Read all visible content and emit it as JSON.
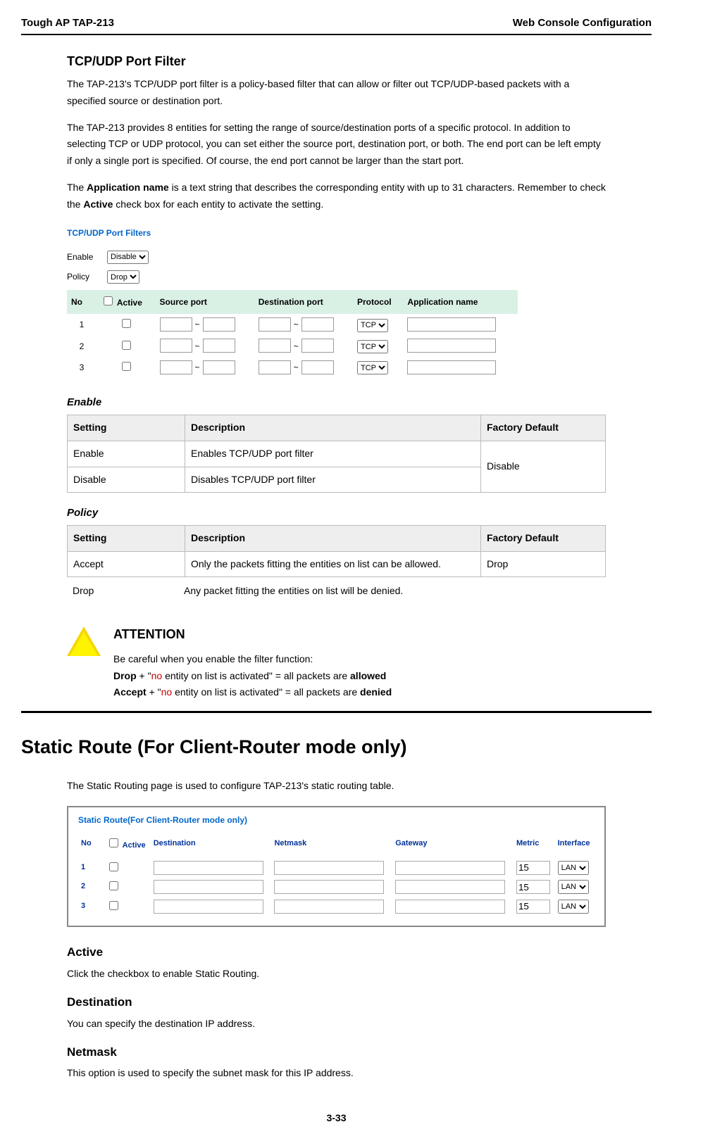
{
  "header": {
    "left": "Tough AP TAP-213",
    "right": "Web Console Configuration"
  },
  "s1": {
    "title": "TCP/UDP Port Filter",
    "p1": "The TAP-213's TCP/UDP port filter is a policy-based filter that can allow or filter out TCP/UDP-based packets with a specified source or destination port.",
    "p2": "The TAP-213 provides 8 entities for setting the range of source/destination ports of a specific protocol. In addition to selecting TCP or UDP protocol, you can set either the source port, destination port, or both. The end port can be left empty if only a single port is specified. Of course, the end port cannot be larger than the start port.",
    "p3_a": "The ",
    "p3_b": "Application name",
    "p3_c": " is a text string that describes the corresponding entity with up to 31 characters. Remember to check the ",
    "p3_d": "Active",
    "p3_e": " check box for each entity to activate the setting."
  },
  "fig1": {
    "title": "TCP/UDP Port Filters",
    "enable_label": "Enable",
    "enable_value": "Disable",
    "policy_label": "Policy",
    "policy_value": "Drop",
    "cols": {
      "no": "No",
      "active": "Active",
      "src": "Source port",
      "dst": "Destination port",
      "proto": "Protocol",
      "app": "Application name"
    },
    "rows": [
      {
        "no": "1",
        "proto": "TCP"
      },
      {
        "no": "2",
        "proto": "TCP"
      },
      {
        "no": "3",
        "proto": "TCP"
      }
    ]
  },
  "t1": {
    "title": "Enable",
    "h1": "Setting",
    "h2": "Description",
    "h3": "Factory Default",
    "r1c1": "Enable",
    "r1c2": "Enables TCP/UDP port filter",
    "fd": "Disable",
    "r2c1": "Disable",
    "r2c2": "Disables TCP/UDP port filter"
  },
  "t2": {
    "title": "Policy",
    "h1": "Setting",
    "h2": "Description",
    "h3": "Factory Default",
    "r1c1": "Accept",
    "r1c2": "Only the packets fitting the entities on list can be allowed.",
    "fd": "Drop",
    "r2c1": "Drop",
    "r2c2": "Any packet fitting the entities on list will be denied."
  },
  "att": {
    "title": "ATTENTION",
    "l1": "Be careful when you enable the filter function:",
    "l2a": "Drop",
    "l2b": " + \"",
    "l2c": "no",
    "l2d": " entity on list is activated\" = all packets are ",
    "l2e": "allowed",
    "l3a": "Accept",
    "l3b": " + \"",
    "l3c": "no",
    "l3d": " entity on list is activated\" = all packets are ",
    "l3e": "denied"
  },
  "s2": {
    "title": "Static Route (For Client-Router mode only)",
    "p1": "The Static Routing page is used to configure TAP-213's static routing table."
  },
  "fig2": {
    "title": "Static Route(For Client-Router mode only)",
    "cols": {
      "no": "No",
      "active": "Active",
      "dest": "Destination",
      "netmask": "Netmask",
      "gateway": "Gateway",
      "metric": "Metric",
      "iface": "Interface"
    },
    "rows": [
      {
        "no": "1",
        "metric": "15",
        "iface": "LAN"
      },
      {
        "no": "2",
        "metric": "15",
        "iface": "LAN"
      },
      {
        "no": "3",
        "metric": "15",
        "iface": "LAN"
      }
    ]
  },
  "subs": {
    "active_t": "Active",
    "active_p": "Click the checkbox to enable Static Routing.",
    "dest_t": "Destination",
    "dest_p": "You can specify the destination IP address.",
    "net_t": "Netmask",
    "net_p": "This option is used to specify the subnet mask for this IP address."
  },
  "footer": "3-33"
}
